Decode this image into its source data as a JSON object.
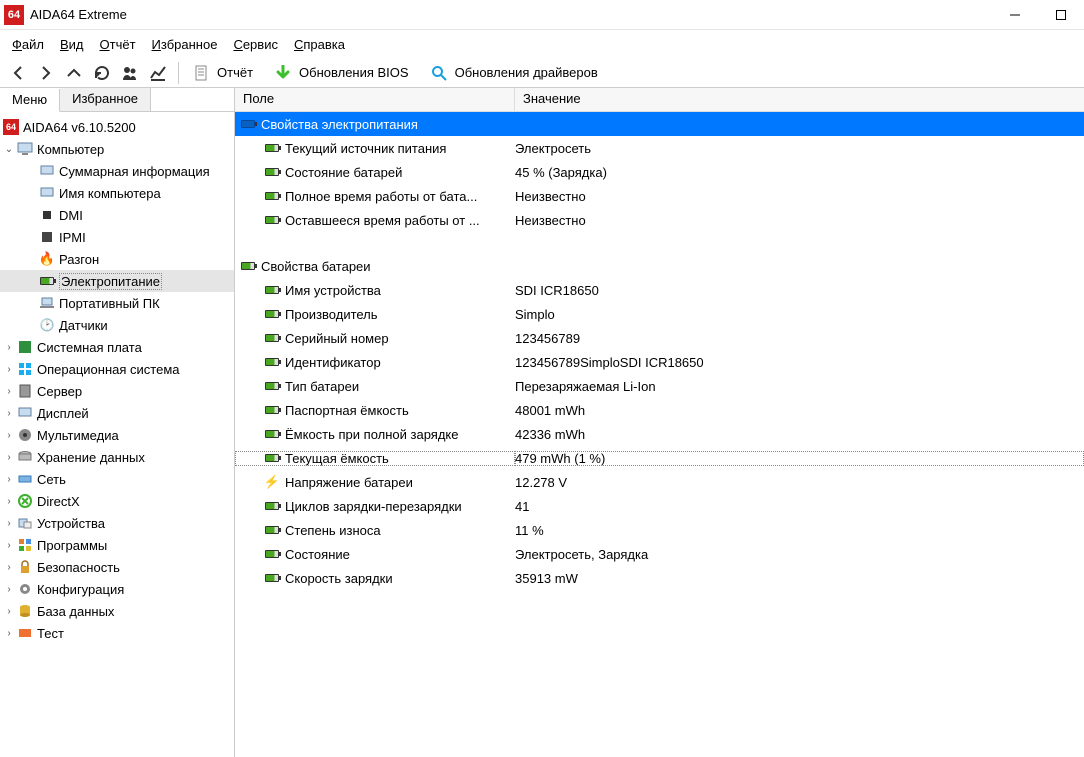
{
  "window": {
    "title": "AIDA64 Extreme",
    "icon_text": "64"
  },
  "menu": {
    "items": [
      "Файл",
      "Вид",
      "Отчёт",
      "Избранное",
      "Сервис",
      "Справка"
    ]
  },
  "toolbar": {
    "report_label": "Отчёт",
    "bios_label": "Обновления BIOS",
    "drivers_label": "Обновления драйверов"
  },
  "sidebar": {
    "tabs": {
      "menu": "Меню",
      "favorites": "Избранное"
    },
    "root": "AIDA64 v6.10.5200",
    "computer": {
      "label": "Компьютер",
      "children": [
        "Суммарная информация",
        "Имя компьютера",
        "DMI",
        "IPMI",
        "Разгон",
        "Электропитание",
        "Портативный ПК",
        "Датчики"
      ]
    },
    "items": [
      "Системная плата",
      "Операционная система",
      "Сервер",
      "Дисплей",
      "Мультимедиа",
      "Хранение данных",
      "Сеть",
      "DirectX",
      "Устройства",
      "Программы",
      "Безопасность",
      "Конфигурация",
      "База данных",
      "Тест"
    ]
  },
  "content": {
    "headers": {
      "field": "Поле",
      "value": "Значение"
    },
    "group1": {
      "title": "Свойства электропитания",
      "rows": [
        {
          "field": "Текущий источник питания",
          "value": "Электросеть"
        },
        {
          "field": "Состояние батарей",
          "value": "45 % (Зарядка)"
        },
        {
          "field": "Полное время работы от бата...",
          "value": "Неизвестно"
        },
        {
          "field": "Оставшееся время работы от ...",
          "value": "Неизвестно"
        }
      ]
    },
    "group2": {
      "title": "Свойства батареи",
      "rows": [
        {
          "field": "Имя устройства",
          "value": "SDI ICR18650"
        },
        {
          "field": "Производитель",
          "value": "Simplo"
        },
        {
          "field": "Серийный номер",
          "value": "123456789"
        },
        {
          "field": "Идентификатор",
          "value": "123456789SimploSDI ICR18650"
        },
        {
          "field": "Тип батареи",
          "value": "Перезаряжаемая Li-Ion"
        },
        {
          "field": "Паспортная ёмкость",
          "value": "48001 mWh"
        },
        {
          "field": "Ёмкость при полной зарядке",
          "value": "42336 mWh"
        },
        {
          "field": "Текущая ёмкость",
          "value": "479 mWh  (1 %)",
          "dotted": true
        },
        {
          "field": "Напряжение батареи",
          "value": "12.278 V",
          "bolt": true
        },
        {
          "field": "Циклов зарядки-перезарядки",
          "value": "41"
        },
        {
          "field": "Степень износа",
          "value": "11 %"
        },
        {
          "field": "Состояние",
          "value": "Электросеть, Зарядка"
        },
        {
          "field": "Скорость зарядки",
          "value": "35913 mW"
        }
      ]
    }
  }
}
